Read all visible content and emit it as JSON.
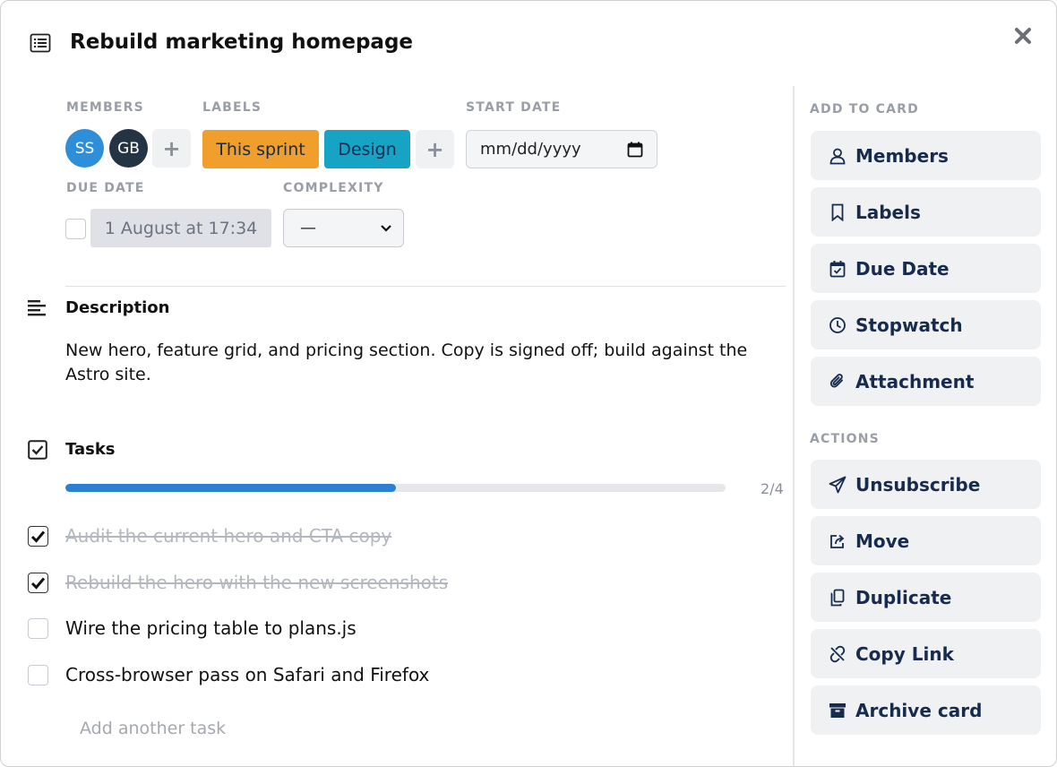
{
  "card": {
    "title": "Rebuild marketing homepage"
  },
  "fields": {
    "members_label": "MEMBERS",
    "labels_label": "LABELS",
    "start_date_label": "START DATE",
    "due_date_label": "DUE DATE",
    "complexity_label": "COMPLEXITY",
    "members": [
      {
        "initials": "SS",
        "color": "#2e8fd8"
      },
      {
        "initials": "GB",
        "color": "#243444"
      }
    ],
    "labels": [
      {
        "text": "This sprint",
        "color": "#f09e2c"
      },
      {
        "text": "Design",
        "color": "#16a3c4"
      }
    ],
    "start_date_placeholder": "mm/dd/yyyy",
    "due_date_value": "1 August at 17:34",
    "complexity_value": "—"
  },
  "description": {
    "heading": "Description",
    "text": "New hero, feature grid, and pricing section. Copy is signed off; build against the Astro site."
  },
  "tasks": {
    "heading": "Tasks",
    "progress_text": "2/4",
    "progress_fraction": 0.5,
    "items": [
      {
        "text": "Audit the current hero and CTA copy",
        "done": true
      },
      {
        "text": "Rebuild the hero with the new screenshots",
        "done": true
      },
      {
        "text": "Wire the pricing table to plans.js",
        "done": false
      },
      {
        "text": "Cross-browser pass on Safari and Firefox",
        "done": false
      }
    ],
    "add_placeholder": "Add another task"
  },
  "sidebar": {
    "add_to_card_label": "ADD TO CARD",
    "add_buttons": [
      {
        "label": "Members",
        "icon": "user-icon"
      },
      {
        "label": "Labels",
        "icon": "bookmark-icon"
      },
      {
        "label": "Due Date",
        "icon": "calendar-check-icon"
      },
      {
        "label": "Stopwatch",
        "icon": "clock-icon"
      },
      {
        "label": "Attachment",
        "icon": "paperclip-icon"
      }
    ],
    "actions_label": "ACTIONS",
    "action_buttons": [
      {
        "label": "Unsubscribe",
        "icon": "paper-plane-icon"
      },
      {
        "label": "Move",
        "icon": "share-icon"
      },
      {
        "label": "Duplicate",
        "icon": "copy-icon"
      },
      {
        "label": "Copy Link",
        "icon": "unlink-icon"
      },
      {
        "label": "Archive card",
        "icon": "archive-icon"
      }
    ]
  },
  "colors": {
    "progress": "#2c7fd1",
    "button_bg": "#f0f1f2"
  }
}
